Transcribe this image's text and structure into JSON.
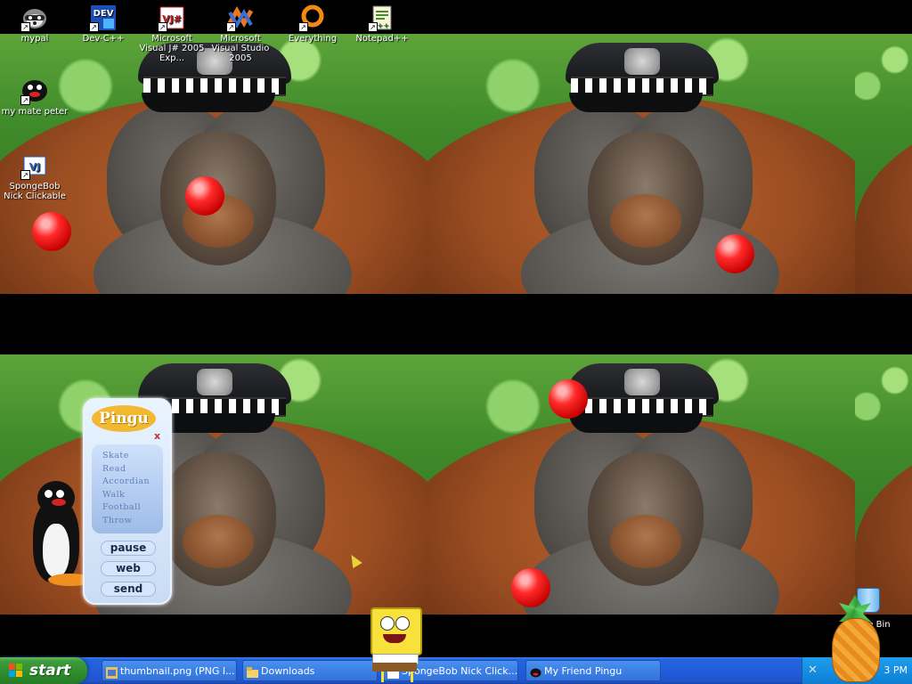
{
  "desktop_icons": [
    {
      "name": "mypal",
      "label": "mypal"
    },
    {
      "name": "dev-cpp",
      "label": "Dev-C++"
    },
    {
      "name": "vj-express",
      "label": "Microsoft Visual J# 2005 Exp..."
    },
    {
      "name": "visual-studio",
      "label": "Microsoft Visual Studio 2005"
    },
    {
      "name": "everything",
      "label": "Everything"
    },
    {
      "name": "notepad-pp",
      "label": "Notepad++"
    },
    {
      "name": "my-mate-peter",
      "label": "my mate peter"
    },
    {
      "name": "spongebob",
      "label": "SpongeBob Nick Clickable"
    }
  ],
  "pingu_widget": {
    "title": "Pingu",
    "close": "x",
    "menu": [
      "Skate",
      "Read",
      "Accordian",
      "Walk",
      "Football",
      "Throw"
    ],
    "buttons": {
      "pause": "pause",
      "web": "web",
      "send": "send"
    }
  },
  "recycle_bin": {
    "label": "cle Bin"
  },
  "taskbar": {
    "start_label": "start",
    "tasks": [
      {
        "label": "thumbnail.png (PNG I..."
      },
      {
        "label": "Downloads"
      },
      {
        "label": "SpongeBob Nick Click..."
      },
      {
        "label": "My Friend Pingu"
      }
    ],
    "clock": "3 PM"
  },
  "colors": {
    "taskbar": "#245ddb",
    "start_green": "#3c9b3a",
    "ball_red": "#ff2a2a"
  }
}
